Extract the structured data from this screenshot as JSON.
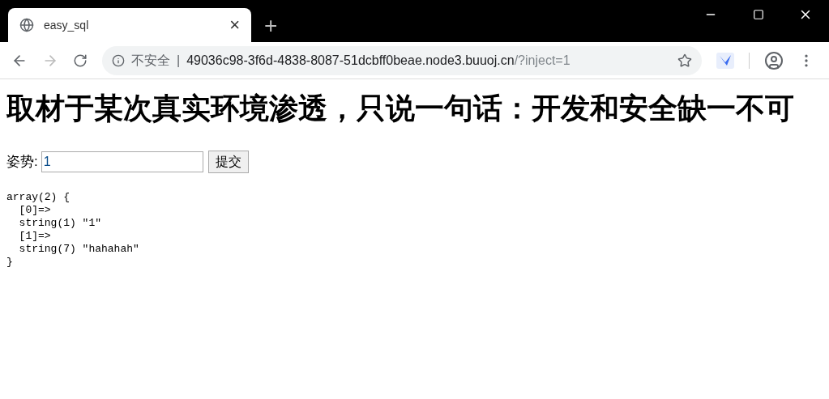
{
  "tab": {
    "title": "easy_sql",
    "close": "×",
    "new_tab": "+"
  },
  "address_bar": {
    "security": "不安全",
    "separator": "|",
    "host": "49036c98-3f6d-4838-8087-51dcbff0beae.node3.buuoj.cn",
    "path": "/?inject=1"
  },
  "page": {
    "heading": "取材于某次真实环境渗透，只说一句话：开发和安全缺一不可",
    "form": {
      "label": "姿势:",
      "value": "1",
      "button": "提交"
    },
    "output": [
      "array(2) {",
      "  [0]=>",
      "  string(1) \"1\"",
      "  [1]=>",
      "  string(7) \"hahahah\"",
      "}"
    ]
  }
}
